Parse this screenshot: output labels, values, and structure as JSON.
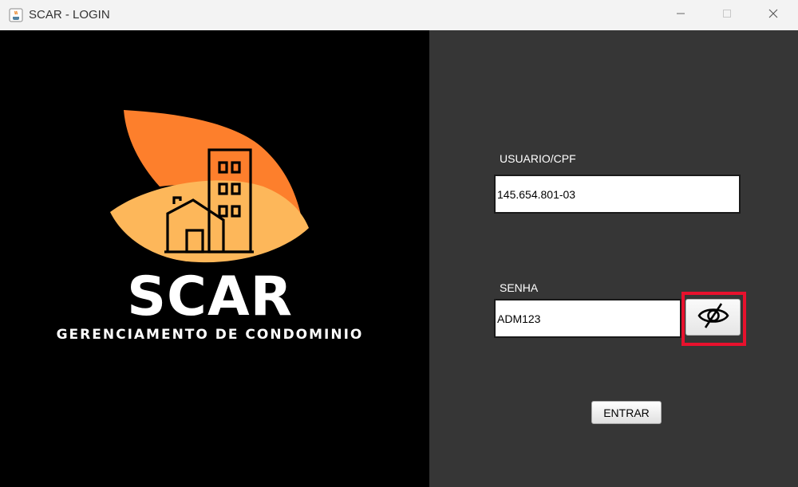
{
  "window": {
    "title": "SCAR - LOGIN",
    "app_icon": "java-coffee-icon",
    "controls": [
      "minimize-icon",
      "maximize-icon",
      "close-icon"
    ]
  },
  "brand": {
    "logo_icon": "building-house-leaf-logo",
    "name": "SCAR",
    "tagline": "GERENCIAMENTO DE CONDOMINIO",
    "colors": {
      "leaf_dark": "#fd7f2c",
      "leaf_light": "#fdb75a",
      "text": "#ffffff",
      "background": "#000000"
    }
  },
  "login_form": {
    "user_label": "USUARIO/CPF",
    "user_value": "145.654.801-03",
    "password_label": "SENHA",
    "password_value": "ADM123",
    "toggle_visibility_icon": "eye-slash-icon",
    "submit_label": "ENTRAR",
    "highlight_color": "#e8112d",
    "panel_color": "#363636"
  }
}
